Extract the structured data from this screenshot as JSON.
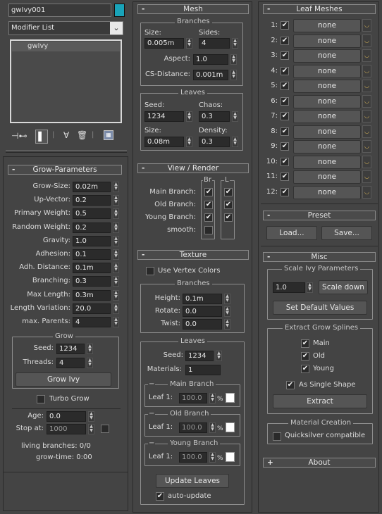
{
  "object": {
    "name": "gwIvy001",
    "color": "#19a3b9"
  },
  "modifier": {
    "list_label": "Modifier List",
    "dropdown_icon": "chevron-down-icon",
    "stack_items": [
      "gwIvy"
    ]
  },
  "toolbar": {
    "icons": [
      "pin-stack-icon",
      "show-end-result-icon",
      "make-unique-icon",
      "remove-modifier-icon",
      "configure-modifier-sets-icon"
    ]
  },
  "grow_params": {
    "title": "Grow-Parameters",
    "collapse": "-",
    "fields": [
      {
        "label": "Grow-Size:",
        "value": "0.02m"
      },
      {
        "label": "Up-Vector:",
        "value": "0.2"
      },
      {
        "label": "Primary Weight:",
        "value": "0.5"
      },
      {
        "label": "Random Weight:",
        "value": "0.2"
      },
      {
        "label": "Gravity:",
        "value": "1.0"
      },
      {
        "label": "Adhesion:",
        "value": "0.1"
      },
      {
        "label": "Adh. Distance:",
        "value": "0.1m"
      },
      {
        "label": "Branching:",
        "value": "0.3"
      },
      {
        "label": "Max Length:",
        "value": "0.3m"
      },
      {
        "label": "Length Variation:",
        "value": "20.0"
      },
      {
        "label": "max. Parents:",
        "value": "4"
      }
    ],
    "grow": {
      "title": "Grow",
      "seed_label": "Seed:",
      "seed": "1234",
      "threads_label": "Threads:",
      "threads": "4",
      "button": "Grow Ivy"
    },
    "turbo": {
      "label": "Turbo Grow",
      "checked": false
    },
    "age_label": "Age:",
    "age": "0.0",
    "stop_label": "Stop at:",
    "stop": "1000",
    "living_branches": "living branches: 0/0",
    "grow_time": "grow-time: 0:00"
  },
  "mesh": {
    "title": "Mesh",
    "collapse": "-",
    "branches": {
      "title": "Branches",
      "size_label": "Size:",
      "size": "0.005m",
      "sides_label": "Sides:",
      "sides": "4",
      "aspect_label": "Aspect:",
      "aspect": "1.0",
      "cs_label": "CS-Distance:",
      "cs": "0.001m"
    },
    "leaves": {
      "title": "Leaves",
      "seed_label": "Seed:",
      "seed": "1234",
      "chaos_label": "Chaos:",
      "chaos": "0.3",
      "size_label": "Size:",
      "size": "0.08m",
      "density_label": "Density:",
      "density": "0.3"
    }
  },
  "view_render": {
    "title": "View / Render",
    "collapse": "-",
    "col_br": "Br",
    "col_l": "L",
    "rows": [
      {
        "label": "Main Branch:",
        "br": true,
        "l": true
      },
      {
        "label": "Old Branch:",
        "br": true,
        "l": true
      },
      {
        "label": "Young Branch:",
        "br": true,
        "l": true
      }
    ],
    "smooth_label": "smooth:",
    "smooth": false
  },
  "texture": {
    "title": "Texture",
    "collapse": "-",
    "vertex_colors": {
      "label": "Use Vertex Colors",
      "checked": false
    },
    "branches": {
      "title": "Branches",
      "height_label": "Height:",
      "height": "0.1m",
      "rotate_label": "Rotate:",
      "rotate": "0.0",
      "twist_label": "Twist:",
      "twist": "0.0"
    },
    "leaves": {
      "title": "Leaves",
      "seed_label": "Seed:",
      "seed": "1234",
      "materials_label": "Materials:",
      "materials": "1",
      "groups": [
        {
          "title": "Main Branch",
          "leaf_label": "Leaf 1:",
          "value": "100.0",
          "unit": "%"
        },
        {
          "title": "Old Branch",
          "leaf_label": "Leaf 1:",
          "value": "100.0",
          "unit": "%"
        },
        {
          "title": "Young Branch",
          "leaf_label": "Leaf 1:",
          "value": "100.0",
          "unit": "%"
        }
      ],
      "update_button": "Update Leaves",
      "auto_update": {
        "label": "auto-update",
        "checked": true
      }
    }
  },
  "leaf_meshes": {
    "title": "Leaf Meshes",
    "collapse": "-",
    "items": [
      {
        "num": "1:",
        "checked": true,
        "name": "none"
      },
      {
        "num": "2:",
        "checked": true,
        "name": "none"
      },
      {
        "num": "3:",
        "checked": true,
        "name": "none"
      },
      {
        "num": "4:",
        "checked": true,
        "name": "none"
      },
      {
        "num": "5:",
        "checked": true,
        "name": "none"
      },
      {
        "num": "6:",
        "checked": true,
        "name": "none"
      },
      {
        "num": "7:",
        "checked": true,
        "name": "none"
      },
      {
        "num": "8:",
        "checked": true,
        "name": "none"
      },
      {
        "num": "9:",
        "checked": true,
        "name": "none"
      },
      {
        "num": "10:",
        "checked": true,
        "name": "none"
      },
      {
        "num": "11:",
        "checked": true,
        "name": "none"
      },
      {
        "num": "12:",
        "checked": true,
        "name": "none"
      }
    ]
  },
  "preset": {
    "title": "Preset",
    "collapse": "-",
    "load": "Load...",
    "save": "Save..."
  },
  "misc": {
    "title": "Misc",
    "collapse": "-",
    "scale": {
      "title": "Scale Ivy Parameters",
      "value": "1.0",
      "scale_down": "Scale down",
      "defaults": "Set Default Values"
    },
    "extract": {
      "title": "Extract Grow Splines",
      "main": "Main",
      "old": "Old",
      "young": "Young",
      "single_shape": "As Single Shape",
      "button": "Extract"
    },
    "material": {
      "title": "Material Creation",
      "quicksilver": "Quicksilver compatible"
    }
  },
  "about": {
    "title": "About",
    "expand": "+"
  },
  "check_glyph": "✔"
}
